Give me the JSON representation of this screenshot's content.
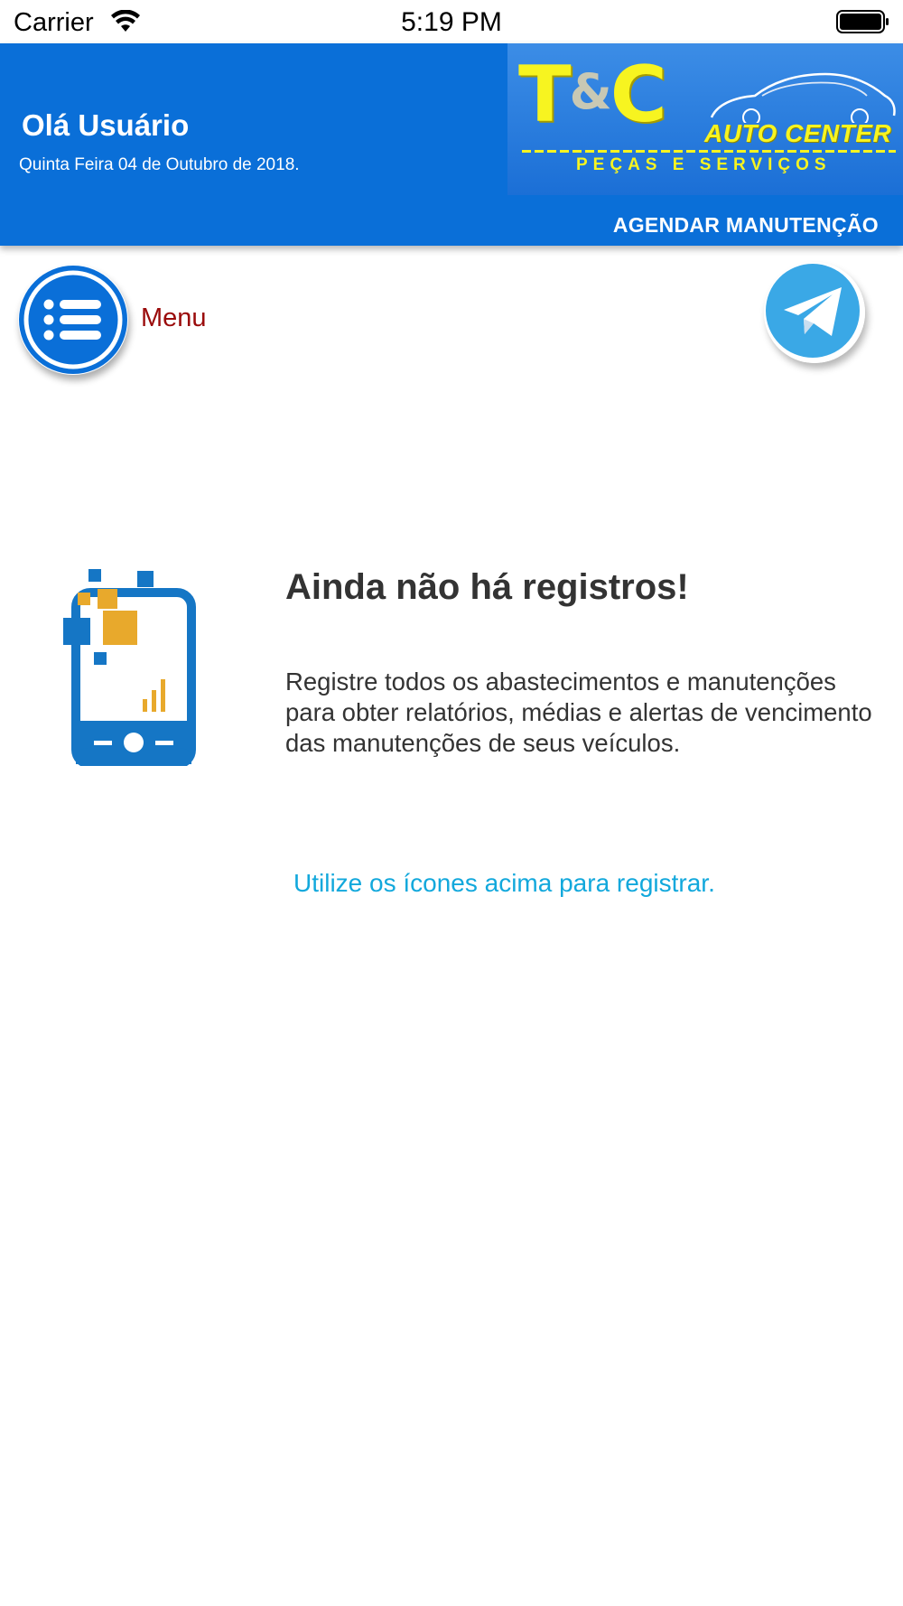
{
  "status_bar": {
    "carrier": "Carrier",
    "time": "5:19 PM"
  },
  "header": {
    "greeting": "Olá Usuário",
    "date": "Quinta Feira 04 de Outubro de 2018.",
    "logo": {
      "tc": "T",
      "amp": "&",
      "c": "C",
      "auto_center": "AUTO CENTER",
      "tagline": "PEÇAS E SERVIÇOS"
    },
    "schedule_link": "AGENDAR MANUTENÇÃO",
    "color": "#0a6fd8"
  },
  "menu": {
    "label": "Menu",
    "icon": "list-menu-icon",
    "color": "#9a0b0b"
  },
  "share": {
    "icon": "telegram-icon"
  },
  "empty_state": {
    "title": "Ainda não há registros!",
    "description": "Registre todos os abastecimentos e manutenções para obter relatórios, médias e alertas de vencimento das manutenções de seus veículos.",
    "hint": "Utilize os ícones acima para registrar.",
    "icon": "phone-chart-icon"
  }
}
